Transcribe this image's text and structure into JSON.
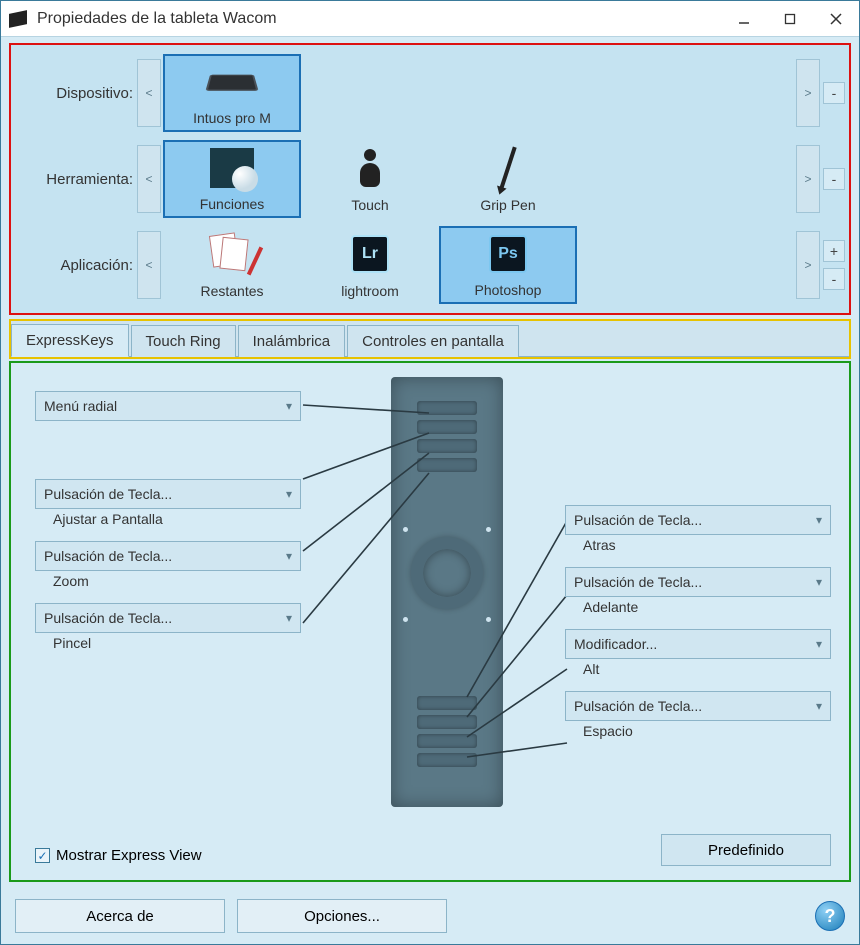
{
  "window": {
    "title": "Propiedades de la tableta Wacom"
  },
  "selectors": {
    "device_label": "Dispositivo:",
    "tool_label": "Herramienta:",
    "app_label": "Aplicación:",
    "devices": [
      {
        "label": "Intuos pro M",
        "selected": true
      }
    ],
    "tools": [
      {
        "label": "Funciones",
        "selected": true
      },
      {
        "label": "Touch",
        "selected": false
      },
      {
        "label": "Grip Pen",
        "selected": false
      }
    ],
    "apps": [
      {
        "label": "Restantes",
        "selected": false
      },
      {
        "label": "lightroom",
        "selected": false
      },
      {
        "label": "Photoshop",
        "selected": true
      }
    ],
    "scroll_prev": "<",
    "scroll_next": ">",
    "add": "+",
    "remove": "-"
  },
  "tabs": [
    {
      "label": "ExpressKeys",
      "active": true
    },
    {
      "label": "Touch Ring",
      "active": false
    },
    {
      "label": "Inalámbrica",
      "active": false
    },
    {
      "label": "Controles en pantalla",
      "active": false
    }
  ],
  "expresskeys": {
    "left": [
      {
        "combo": "Menú radial",
        "sub": ""
      },
      {
        "combo": "Pulsación de Tecla...",
        "sub": "Ajustar a Pantalla"
      },
      {
        "combo": "Pulsación de Tecla...",
        "sub": "Zoom"
      },
      {
        "combo": "Pulsación de Tecla...",
        "sub": "Pincel"
      }
    ],
    "right": [
      {
        "combo": "Pulsación de Tecla...",
        "sub": "Atras"
      },
      {
        "combo": "Pulsación de Tecla...",
        "sub": "Adelante"
      },
      {
        "combo": "Modificador...",
        "sub": "Alt"
      },
      {
        "combo": "Pulsación de Tecla...",
        "sub": "Espacio"
      }
    ],
    "show_express_view": "Mostrar Express View",
    "preset_button": "Predefinido"
  },
  "footer": {
    "about": "Acerca de",
    "options": "Opciones...",
    "help": "?"
  }
}
